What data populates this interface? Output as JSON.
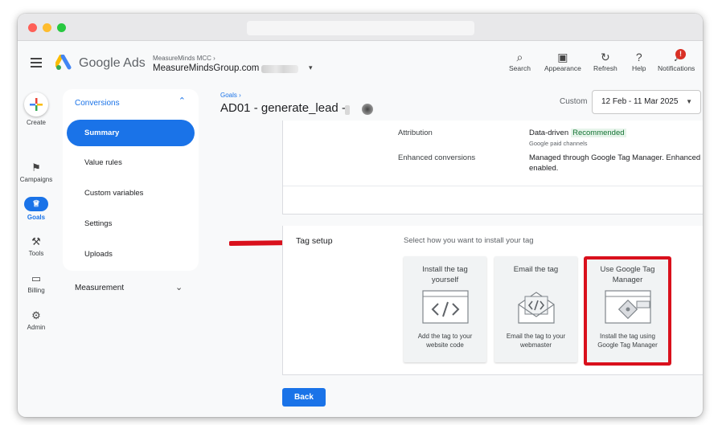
{
  "app": {
    "brand": "Google Ads",
    "account_small": "MeasureMinds MCC",
    "account_caret_small": "›",
    "account_main": "MeasureMindsGroup.com",
    "account_dropdown_icon": "▾"
  },
  "toolbar": {
    "items": [
      {
        "label": "Search",
        "icon": "search-icon",
        "glyph": "⌕"
      },
      {
        "label": "Appearance",
        "icon": "appearance-icon",
        "glyph": "▣"
      },
      {
        "label": "Refresh",
        "icon": "refresh-icon",
        "glyph": "↻"
      },
      {
        "label": "Help",
        "icon": "help-icon",
        "glyph": "?"
      },
      {
        "label": "Notifications",
        "icon": "bell-icon",
        "glyph": "♪",
        "badge": "!"
      }
    ]
  },
  "rail": {
    "create": "Create",
    "items": [
      {
        "label": "Campaigns",
        "glyph": "⚑"
      },
      {
        "label": "Goals",
        "glyph": "♕"
      },
      {
        "label": "Tools",
        "glyph": "⚒"
      },
      {
        "label": "Billing",
        "glyph": "▭"
      },
      {
        "label": "Admin",
        "glyph": "⚙"
      }
    ]
  },
  "subnav": {
    "header": "Conversions",
    "header_caret": "⌃",
    "items": [
      "Summary",
      "Value rules",
      "Custom variables",
      "Settings",
      "Uploads"
    ],
    "measurement": "Measurement",
    "measurement_caret": "⌄"
  },
  "page": {
    "breadcrumb": "Goals ›",
    "title": "AD01 - generate_lead -",
    "custom_label": "Custom",
    "date_range": "12 Feb - 11 Mar 2025",
    "date_caret": "▼"
  },
  "settings": {
    "attribution_label": "Attribution",
    "attribution_value": "Data-driven",
    "attribution_badge": "Recommended",
    "attribution_sub": "Google paid channels",
    "enhanced_label": "Enhanced conversions",
    "enhanced_value_line1": "Managed through Google Tag Manager.  Enhanced",
    "enhanced_value_line2": "enabled."
  },
  "tag_setup": {
    "heading": "Tag setup",
    "description": "Select how you want to install your tag",
    "options": [
      {
        "title": "Install the tag yourself",
        "desc": "Add the tag to your website code",
        "icon": "code-window-icon"
      },
      {
        "title": "Email the tag",
        "desc": "Email the tag to your webmaster",
        "icon": "email-code-icon"
      },
      {
        "title": "Use Google Tag Manager",
        "desc": "Install the tag using Google Tag Manager",
        "icon": "tag-manager-icon"
      }
    ],
    "highlight_color": "#d9101c"
  },
  "footer": {
    "back": "Back"
  },
  "colors": {
    "accent": "#1a73e8",
    "annotation_red": "#d9101c",
    "recommended_bg": "#e6f4ea",
    "recommended_text": "#137333"
  }
}
